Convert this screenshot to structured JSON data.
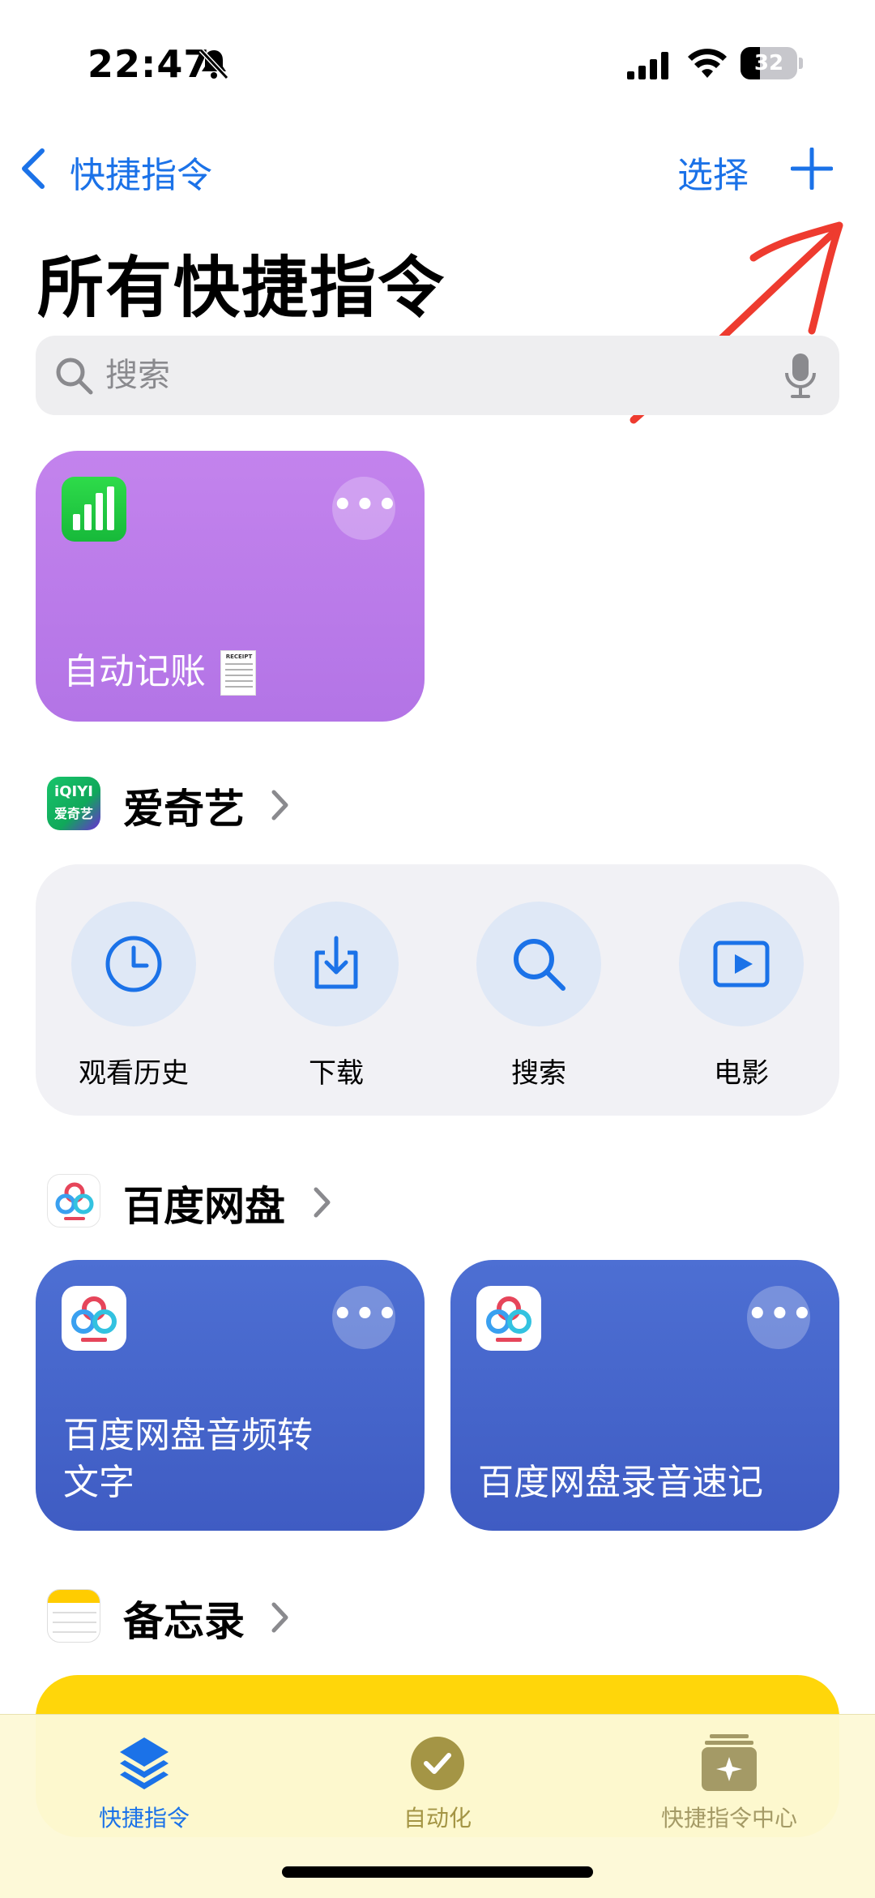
{
  "status": {
    "time": "22:47",
    "battery": "32"
  },
  "nav": {
    "back_label": "快捷指令",
    "select_label": "选择",
    "add_icon": "plus-icon"
  },
  "page_title": "所有快捷指令",
  "search": {
    "placeholder": "搜索"
  },
  "cards": {
    "auto_bookkeeping": {
      "title": "自动记账",
      "icon": "numbers-app-icon",
      "color": "#b97ae9"
    },
    "baidu_audio_to_text": {
      "title_line1": "百度网盘音频转",
      "title_line2": "文字"
    },
    "baidu_recording": {
      "title": "百度网盘录音速记"
    }
  },
  "groups": {
    "iqiyi": {
      "name": "爱奇艺",
      "icon_text_1": "iQIYI",
      "icon_text_2": "爱奇艺",
      "actions": [
        {
          "label": "观看历史",
          "icon": "clock-icon"
        },
        {
          "label": "下载",
          "icon": "download-icon"
        },
        {
          "label": "搜索",
          "icon": "search-icon"
        },
        {
          "label": "电影",
          "icon": "play-icon"
        }
      ]
    },
    "baidu": {
      "name": "百度网盘",
      "color": "#4566cb"
    },
    "notes": {
      "name": "备忘录",
      "color": "#ffd60a"
    }
  },
  "receipt_text": "RECEIPT",
  "tabs": [
    {
      "label": "快捷指令",
      "icon": "layers-icon",
      "active": true
    },
    {
      "label": "自动化",
      "icon": "checkmark-clock-icon",
      "active": false
    },
    {
      "label": "快捷指令中心",
      "icon": "gallery-icon",
      "active": false
    }
  ],
  "colors": {
    "accent": "#1b72e8",
    "annotation": "#ee3b2f"
  }
}
